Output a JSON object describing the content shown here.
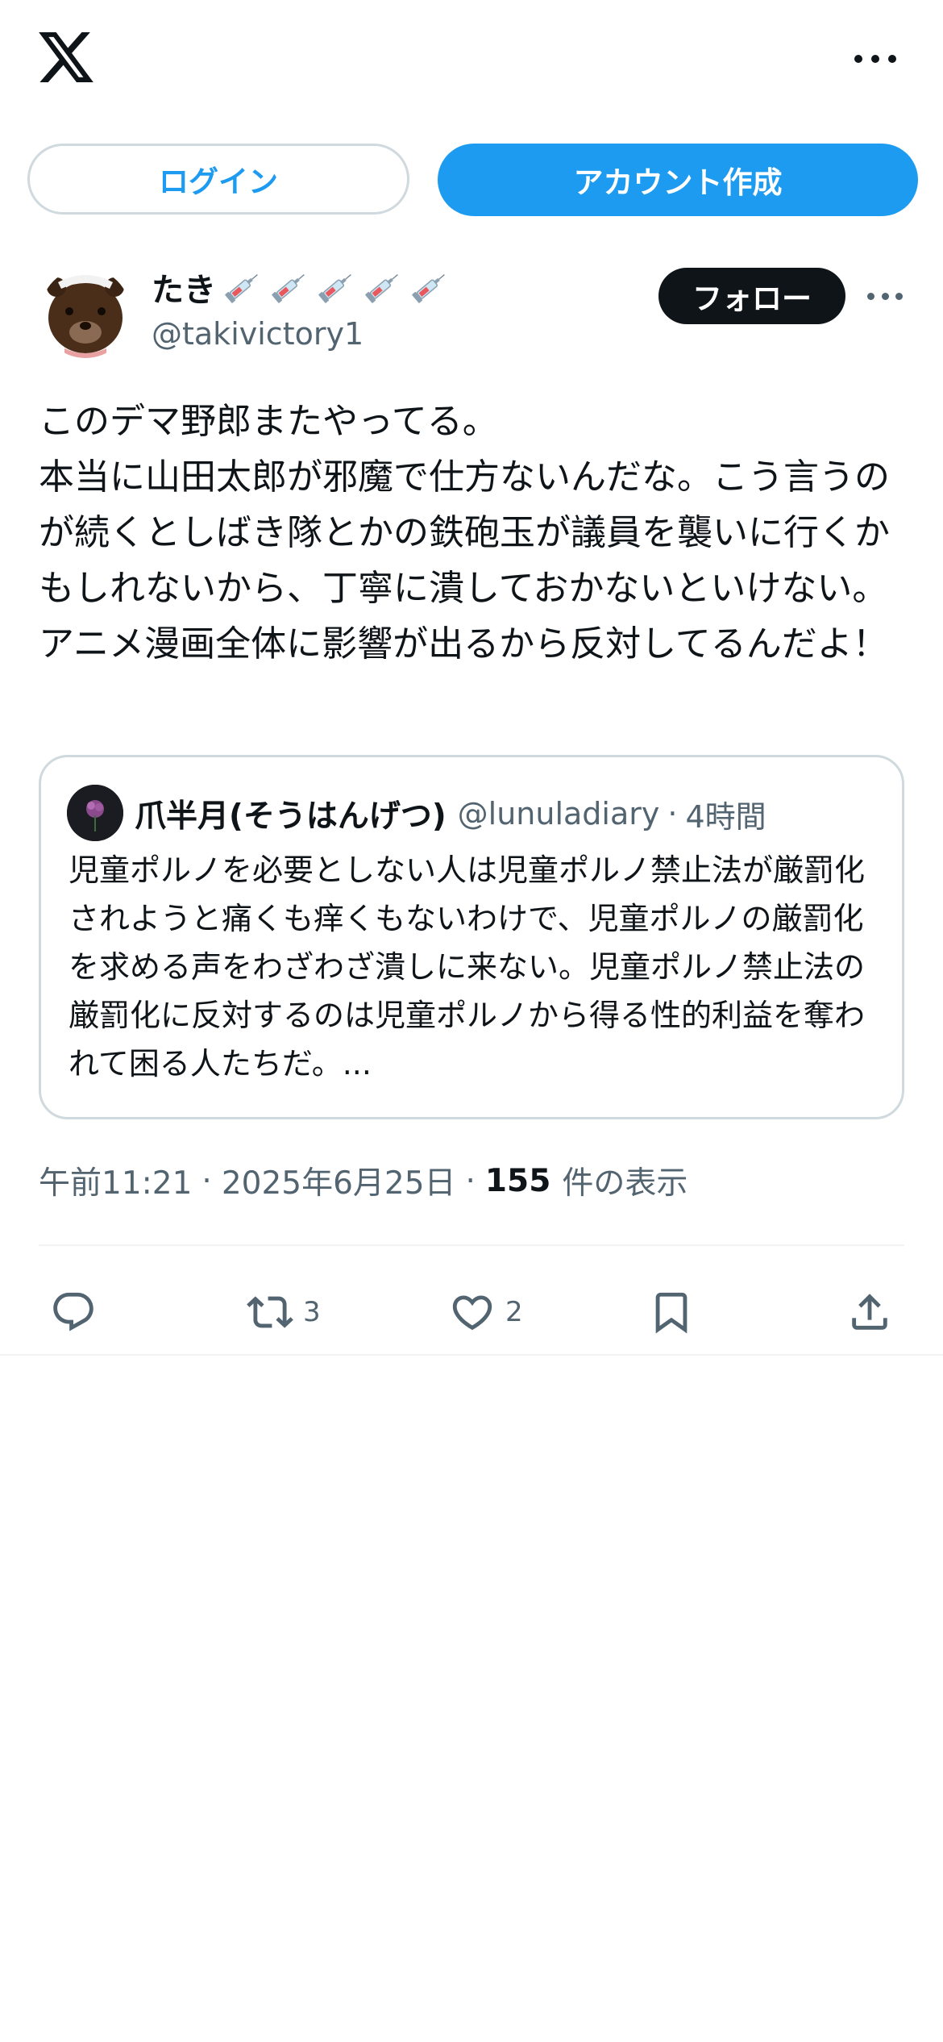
{
  "header": {
    "logo_icon": "x-logo-icon",
    "more_icon": "more-horizontal-icon"
  },
  "auth": {
    "login_label": "ログイン",
    "signup_label": "アカウント作成"
  },
  "tweet": {
    "author_name": "たき",
    "author_name_emoji": "syringe-icon",
    "author_handle": "@takivictory1",
    "follow_label": "フォロー",
    "text": "このデマ野郎またやってる。\n本当に山田太郎が邪魔で仕方ないんだな。こう言うのが続くとしばき隊とかの鉄砲玉が議員を襲いに行くかもしれないから、丁寧に潰しておかないといけない。アニメ漫画全体に影響が出るから反対してるんだよ！",
    "quote": {
      "name": "爪半月(そうはんげつ)",
      "handle": "@lunuladiary",
      "separator": "·",
      "time": "4時間",
      "text": "児童ポルノを必要としない人は児童ポルノ禁止法が厳罰化されようと痛くも痒くもないわけで、児童ポルノの厳罰化を求める声をわざわざ潰しに来ない。児童ポルノ禁止法の厳罰化に反対するのは児童ポルノから得る性的利益を奪われて困る人たちだ。..."
    },
    "meta": {
      "time": "午前11:21",
      "separator": "·",
      "date": "2025年6月25日",
      "views_count": "155",
      "views_label": "件の表示"
    },
    "actions": {
      "reply_count": "",
      "retweet_count": "3",
      "like_count": "2"
    }
  },
  "colors": {
    "accent": "#1d9bf0",
    "text_primary": "#0f1419",
    "text_secondary": "#536471",
    "border": "#cfd9de"
  }
}
